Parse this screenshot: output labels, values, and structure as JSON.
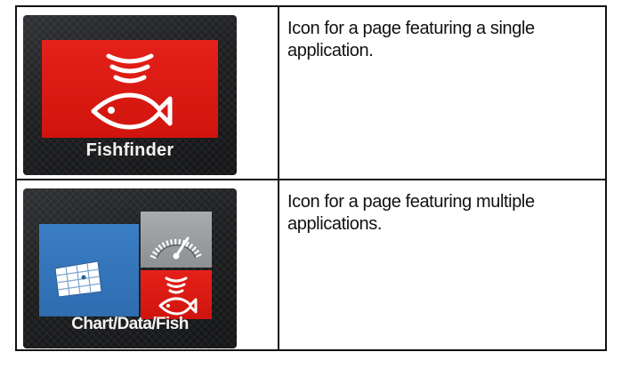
{
  "rows": [
    {
      "icon_label": "Fishfinder",
      "description": "Icon for a page featuring a single application."
    },
    {
      "icon_label": "Chart/Data/Fish",
      "description": "Icon for a page featuring multiple applications."
    }
  ],
  "icons": {
    "single": "fishfinder-icon",
    "multi": [
      "chart-icon",
      "gauge-icon",
      "fishfinder-icon"
    ]
  },
  "colors": {
    "fish_red": "#d9170f",
    "chart_blue": "#3576bb",
    "gauge_grey": "#9a9da0",
    "tile_dark": "#1d1e20"
  }
}
